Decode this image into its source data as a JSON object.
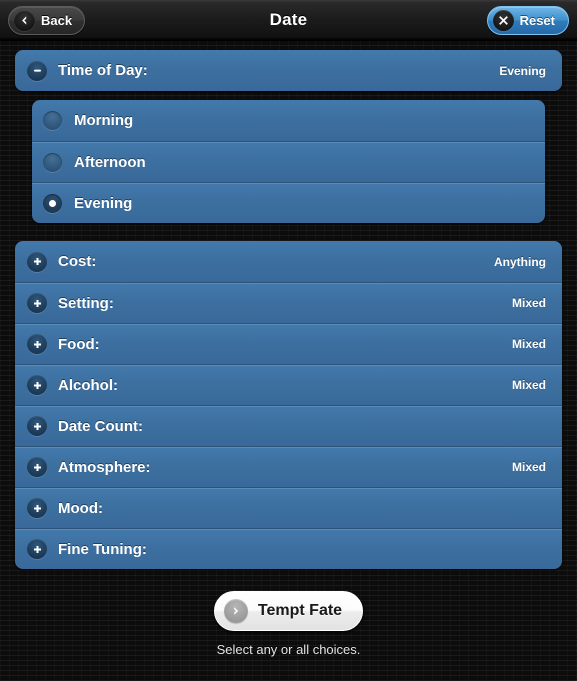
{
  "header": {
    "title": "Date",
    "back_label": "Back",
    "back_icon": "chevron-left-icon",
    "reset_label": "Reset",
    "reset_icon": "close-x-icon"
  },
  "expanded_section": {
    "label": "Time of Day:",
    "value": "Evening",
    "toggle_icon": "minus-icon",
    "options": [
      {
        "label": "Morning",
        "selected": false
      },
      {
        "label": "Afternoon",
        "selected": false
      },
      {
        "label": "Evening",
        "selected": true
      }
    ]
  },
  "sections": [
    {
      "label": "Cost:",
      "value": "Anything",
      "toggle_icon": "plus-icon"
    },
    {
      "label": "Setting:",
      "value": "Mixed",
      "toggle_icon": "plus-icon"
    },
    {
      "label": "Food:",
      "value": "Mixed",
      "toggle_icon": "plus-icon"
    },
    {
      "label": "Alcohol:",
      "value": "Mixed",
      "toggle_icon": "plus-icon"
    },
    {
      "label": "Date Count:",
      "value": "",
      "toggle_icon": "plus-icon"
    },
    {
      "label": "Atmosphere:",
      "value": "Mixed",
      "toggle_icon": "plus-icon"
    },
    {
      "label": "Mood:",
      "value": "",
      "toggle_icon": "plus-icon"
    },
    {
      "label": "Fine Tuning:",
      "value": "",
      "toggle_icon": "plus-icon"
    }
  ],
  "footer": {
    "button_label": "Tempt Fate",
    "button_icon": "arrow-right-circle-icon",
    "note": "Select any or all choices."
  },
  "colors": {
    "row_blue": "#3c6f9f",
    "row_blue_top": "#4379ac",
    "row_divider": "#2c5278",
    "accent_blue": "#3e8fcc",
    "background": "#141414",
    "header_dark": "#1b1b1b"
  }
}
